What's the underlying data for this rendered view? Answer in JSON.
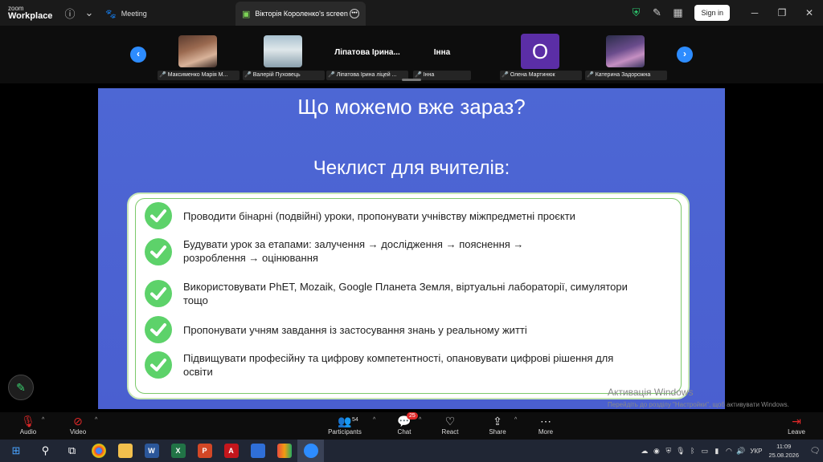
{
  "app": {
    "logo_top": "zoom",
    "logo_bottom": "Workplace"
  },
  "tabs": [
    {
      "label": "Meeting",
      "icon": "paw-icon"
    },
    {
      "label": "Вікторія Короленко's screen",
      "icon": "screen-share-icon"
    }
  ],
  "header": {
    "signin_label": "Sign in"
  },
  "participants": [
    {
      "name": "Максименко Марія М...",
      "display": "photo"
    },
    {
      "name": "Валерій Пуховець",
      "display": "photo"
    },
    {
      "name": "Ліпатова Ірина ліцей ...",
      "display": "Ліпатова Ірина..."
    },
    {
      "name": "Інна",
      "display": "Інна"
    },
    {
      "name": "Олена Мартинюк",
      "display": "О"
    },
    {
      "name": "Катерина Задорожна",
      "display": "photo"
    }
  ],
  "slide": {
    "title": "Що можемо вже зараз?",
    "subtitle": "Чеклист для вчителів:",
    "items": [
      "Проводити бінарні (подвійні) уроки, пропонувати учнівству міжпредметні проєкти",
      "Будувати урок за етапами: залучення → дослідження → пояснення → розроблення → оцінювання",
      "Використовувати PhET, Mozaik, Google Планета Земля, віртуальні лабораторії, симулятори тощо",
      "Пропонувати учням завдання із застосування знань у реальному житті",
      "Підвищувати професійну та цифрову компетентності, опановувати цифрові рішення для освіти"
    ],
    "colors": {
      "background": "#4d67d4",
      "check": "#5dd26a"
    }
  },
  "watermark": {
    "line1": "Активація Windows",
    "line2": "Перейдіть до розділу \"Настройки\", щоб активувати Windows."
  },
  "toolbar": {
    "audio": "Audio",
    "video": "Video",
    "participants": "Participants",
    "participants_count": "54",
    "chat": "Chat",
    "chat_badge": "25",
    "react": "React",
    "share": "Share",
    "more": "More",
    "leave": "Leave"
  },
  "taskbar": {
    "lang": "УКР",
    "time": "11:09",
    "date": "25.08.2026"
  }
}
